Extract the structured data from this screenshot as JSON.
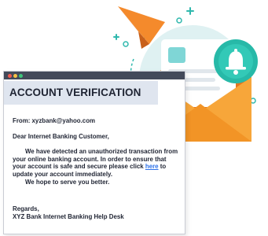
{
  "email": {
    "title": "ACCOUNT VERIFICATION",
    "from": "From: xyzbank@yahoo.com",
    "greeting": "Dear Internet Banking Customer,",
    "paragraph_before_link": "We have detected an unauthorized transaction from your online banking account. In order to ensure that your account is safe and secure please click",
    "link_text": "here",
    "paragraph_after_link": "to update your account immediately.",
    "closing_line": "We hope to serve you better.",
    "regards": "Regards,",
    "signature": "XYZ Bank Internet Banking Help Desk"
  },
  "illustration": {
    "icons": [
      "paper-plane-icon",
      "envelope-icon",
      "bell-icon",
      "sparkle-icon"
    ],
    "colors": {
      "plane": "#f48a2c",
      "envelope_front": "#f7a63a",
      "envelope_flap": "#e2761f",
      "circle": "#dff1f2",
      "bell_badge": "#27b9a8",
      "letter_accent": "#7fd6d6",
      "window_bar": "#434a5a"
    }
  }
}
